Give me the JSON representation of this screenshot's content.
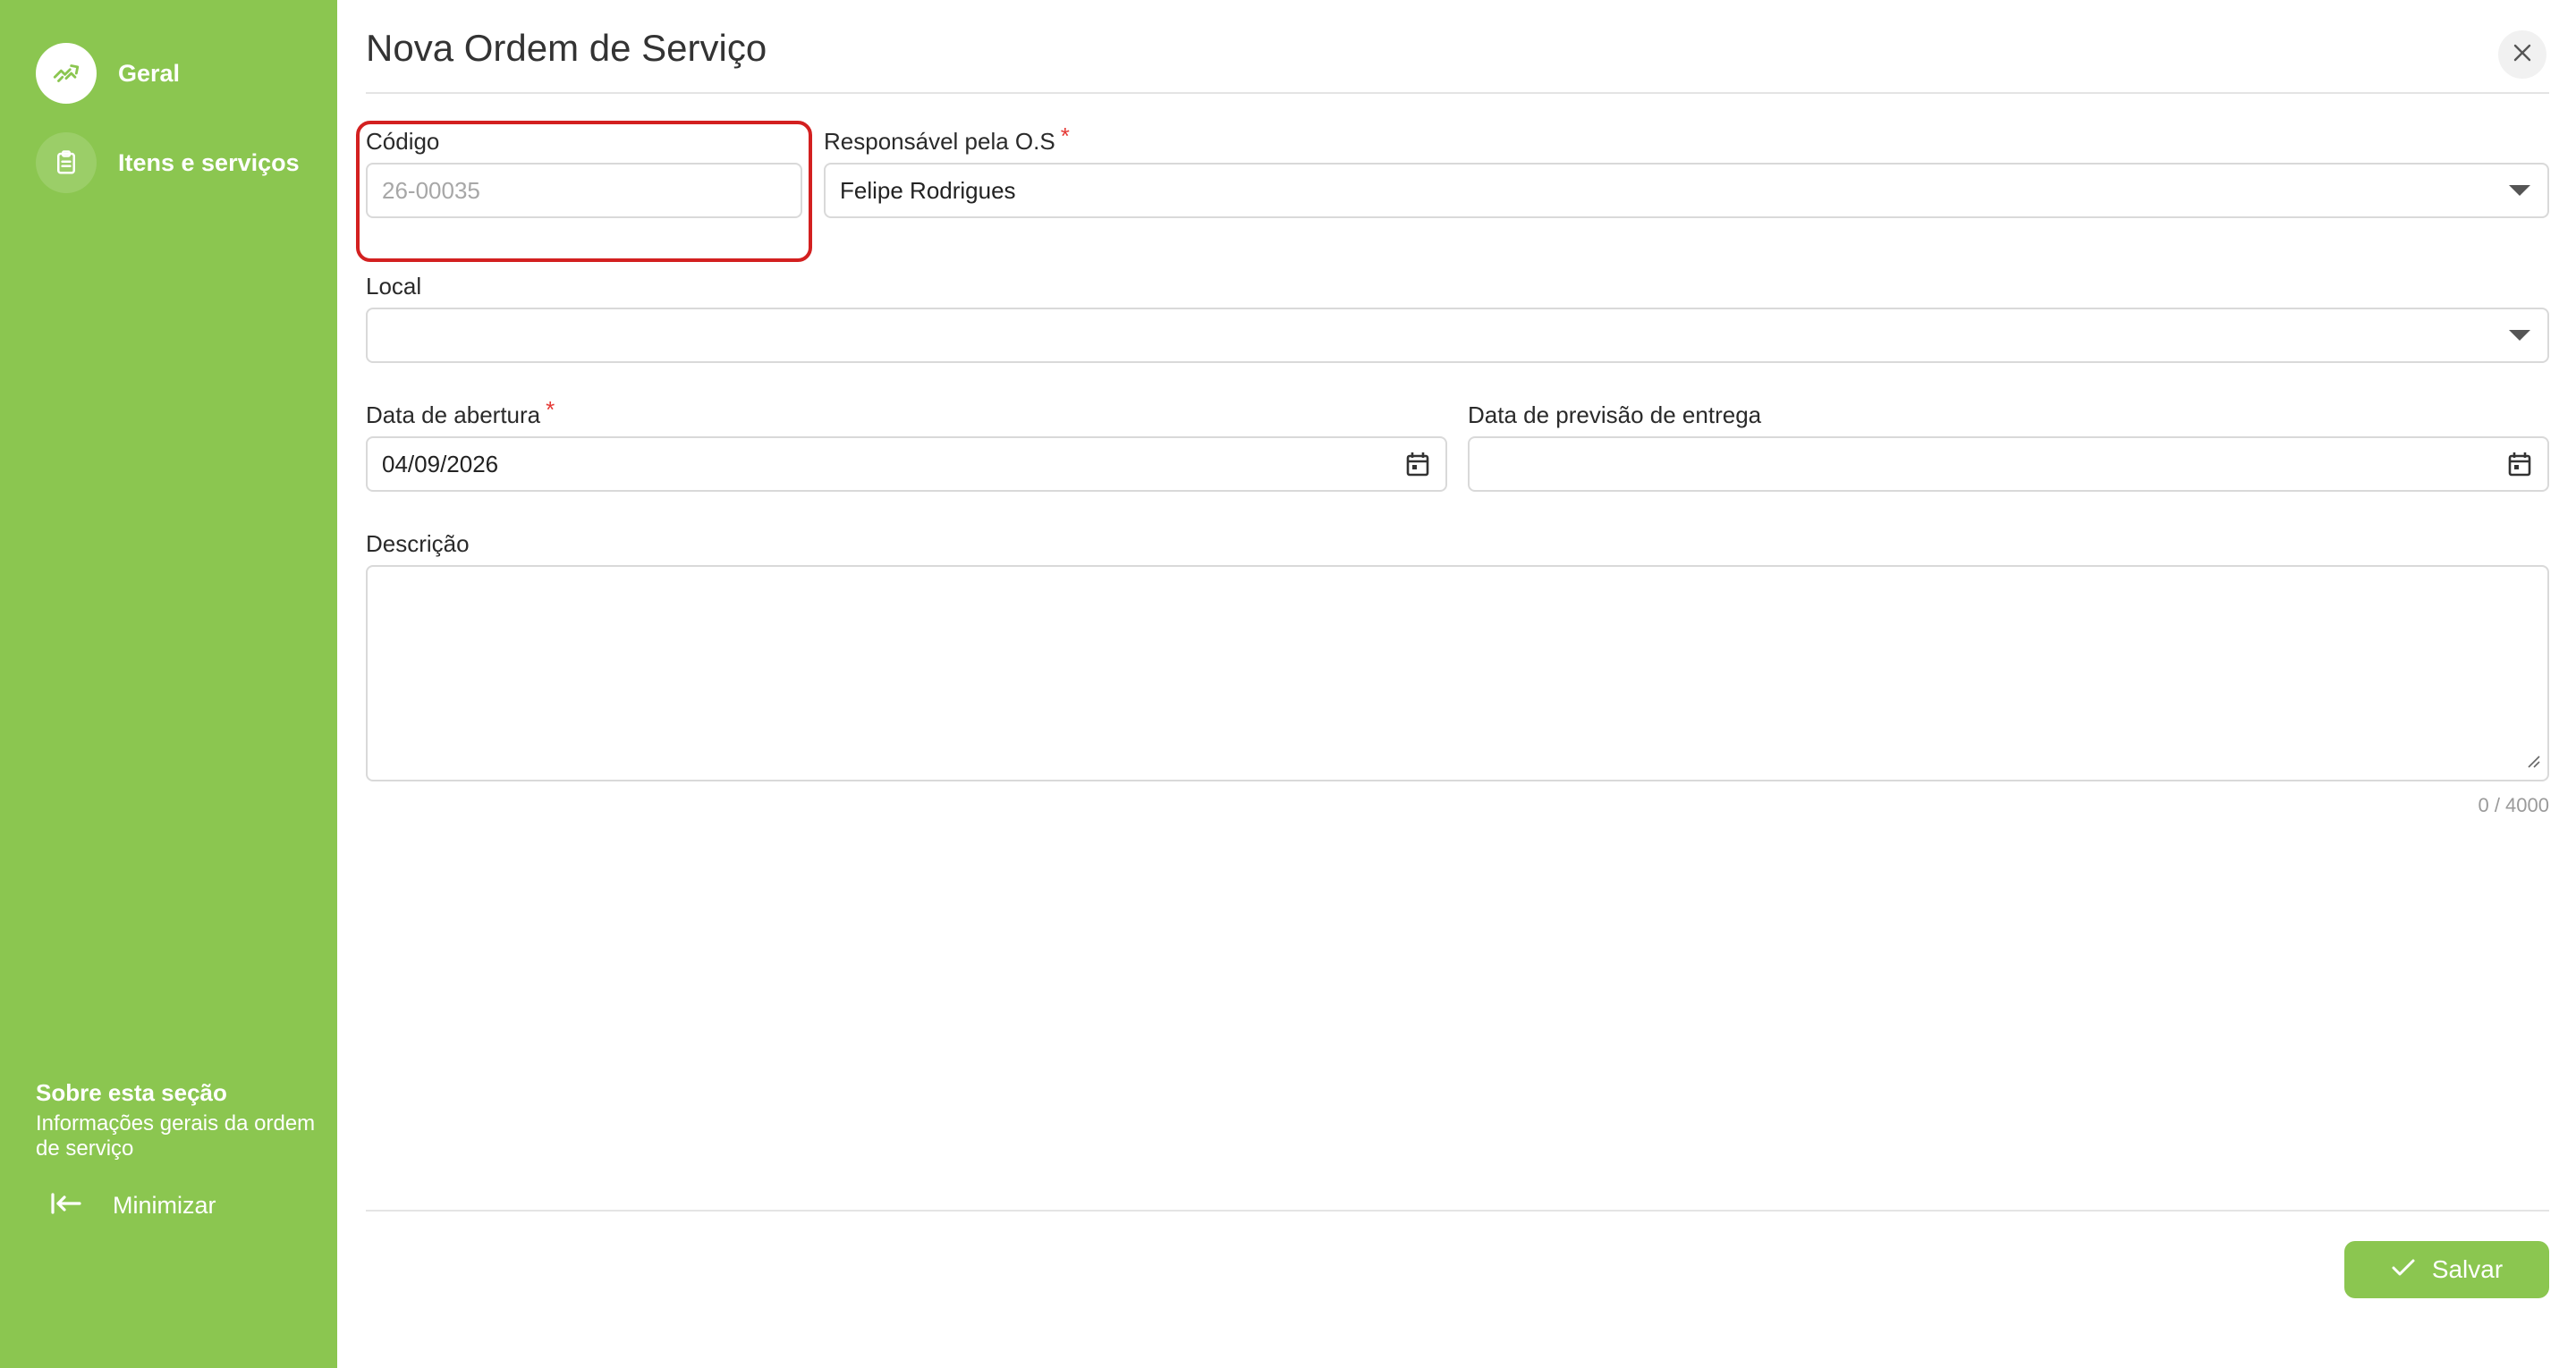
{
  "sidebar": {
    "items": [
      {
        "label": "Geral",
        "icon": "handshake-icon",
        "active": true
      },
      {
        "label": "Itens e serviços",
        "icon": "clipboard-icon",
        "active": false
      }
    ],
    "about": {
      "title": "Sobre esta seção",
      "description": "Informações gerais da ordem de serviço"
    },
    "minimize_label": "Minimizar"
  },
  "header": {
    "title": "Nova Ordem de Serviço"
  },
  "form": {
    "codigo": {
      "label": "Código",
      "placeholder": "26-00035",
      "value": ""
    },
    "responsavel": {
      "label": "Responsável pela O.S",
      "required_mark": "*",
      "value": "Felipe Rodrigues"
    },
    "local": {
      "label": "Local",
      "value": ""
    },
    "data_abertura": {
      "label": "Data de abertura",
      "required_mark": "*",
      "value": "04/09/2026"
    },
    "data_previsao": {
      "label": "Data de previsão de entrega",
      "value": ""
    },
    "descricao": {
      "label": "Descrição",
      "value": "",
      "counter": "0 / 4000"
    }
  },
  "footer": {
    "save_label": "Salvar"
  },
  "colors": {
    "accent": "#8bc650",
    "highlight": "#d32020",
    "required": "#e53935"
  }
}
